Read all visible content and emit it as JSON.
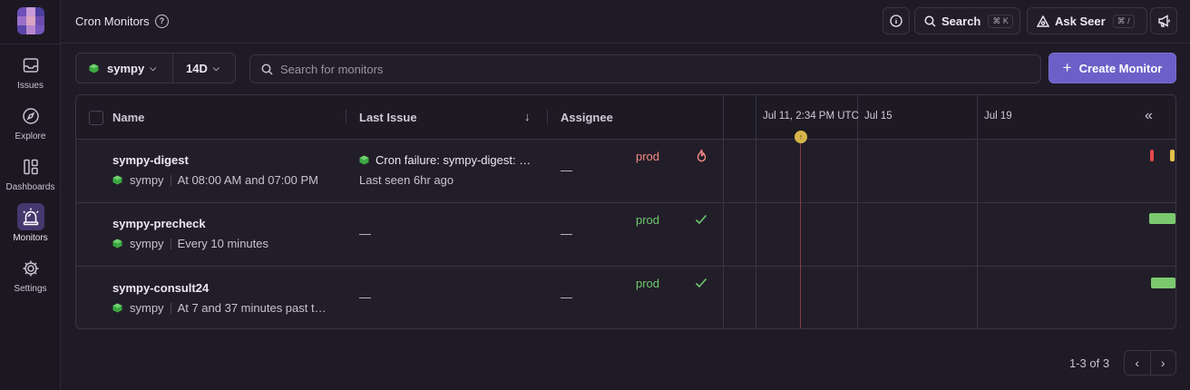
{
  "header": {
    "title": "Cron Monitors",
    "search_label": "Search",
    "search_shortcut": "⌘ K",
    "ask_seer_label": "Ask Seer",
    "ask_seer_shortcut": "⌘ /"
  },
  "sidebar": {
    "items": [
      {
        "label": "Issues",
        "icon": "inbox-icon"
      },
      {
        "label": "Explore",
        "icon": "compass-icon"
      },
      {
        "label": "Dashboards",
        "icon": "dashboard-icon"
      },
      {
        "label": "Monitors",
        "icon": "siren-icon",
        "active": true
      },
      {
        "label": "Settings",
        "icon": "gear-icon"
      }
    ]
  },
  "filters": {
    "project": "sympy",
    "period": "14D",
    "search_placeholder": "Search for monitors",
    "create_label": "Create Monitor"
  },
  "table": {
    "columns": {
      "name": "Name",
      "last_issue": "Last Issue",
      "assignee": "Assignee"
    },
    "timeline_labels": [
      "Jul 11, 2:34 PM UTC",
      "Jul 15",
      "Jul 19"
    ],
    "rows": [
      {
        "name": "sympy-digest",
        "project": "sympy",
        "schedule": "At 08:00 AM and 07:00 PM",
        "issue_title": "Cron failure: sympy-digest: …",
        "issue_seen": "Last seen 6hr ago",
        "assignee": "—",
        "environment": "prod",
        "status": "failing"
      },
      {
        "name": "sympy-precheck",
        "project": "sympy",
        "schedule": "Every 10 minutes",
        "issue_title": "—",
        "assignee": "—",
        "environment": "prod",
        "status": "ok"
      },
      {
        "name": "sympy-consult24",
        "project": "sympy",
        "schedule": "At 7 and 37 minutes past t…",
        "issue_title": "—",
        "assignee": "—",
        "environment": "prod",
        "status": "ok"
      }
    ]
  },
  "pagination": {
    "text": "1-3 of 3"
  },
  "colors": {
    "accent": "#6c5fc7",
    "error": "#f58c83",
    "success": "#6fc96f",
    "warning": "#e5c04a"
  }
}
